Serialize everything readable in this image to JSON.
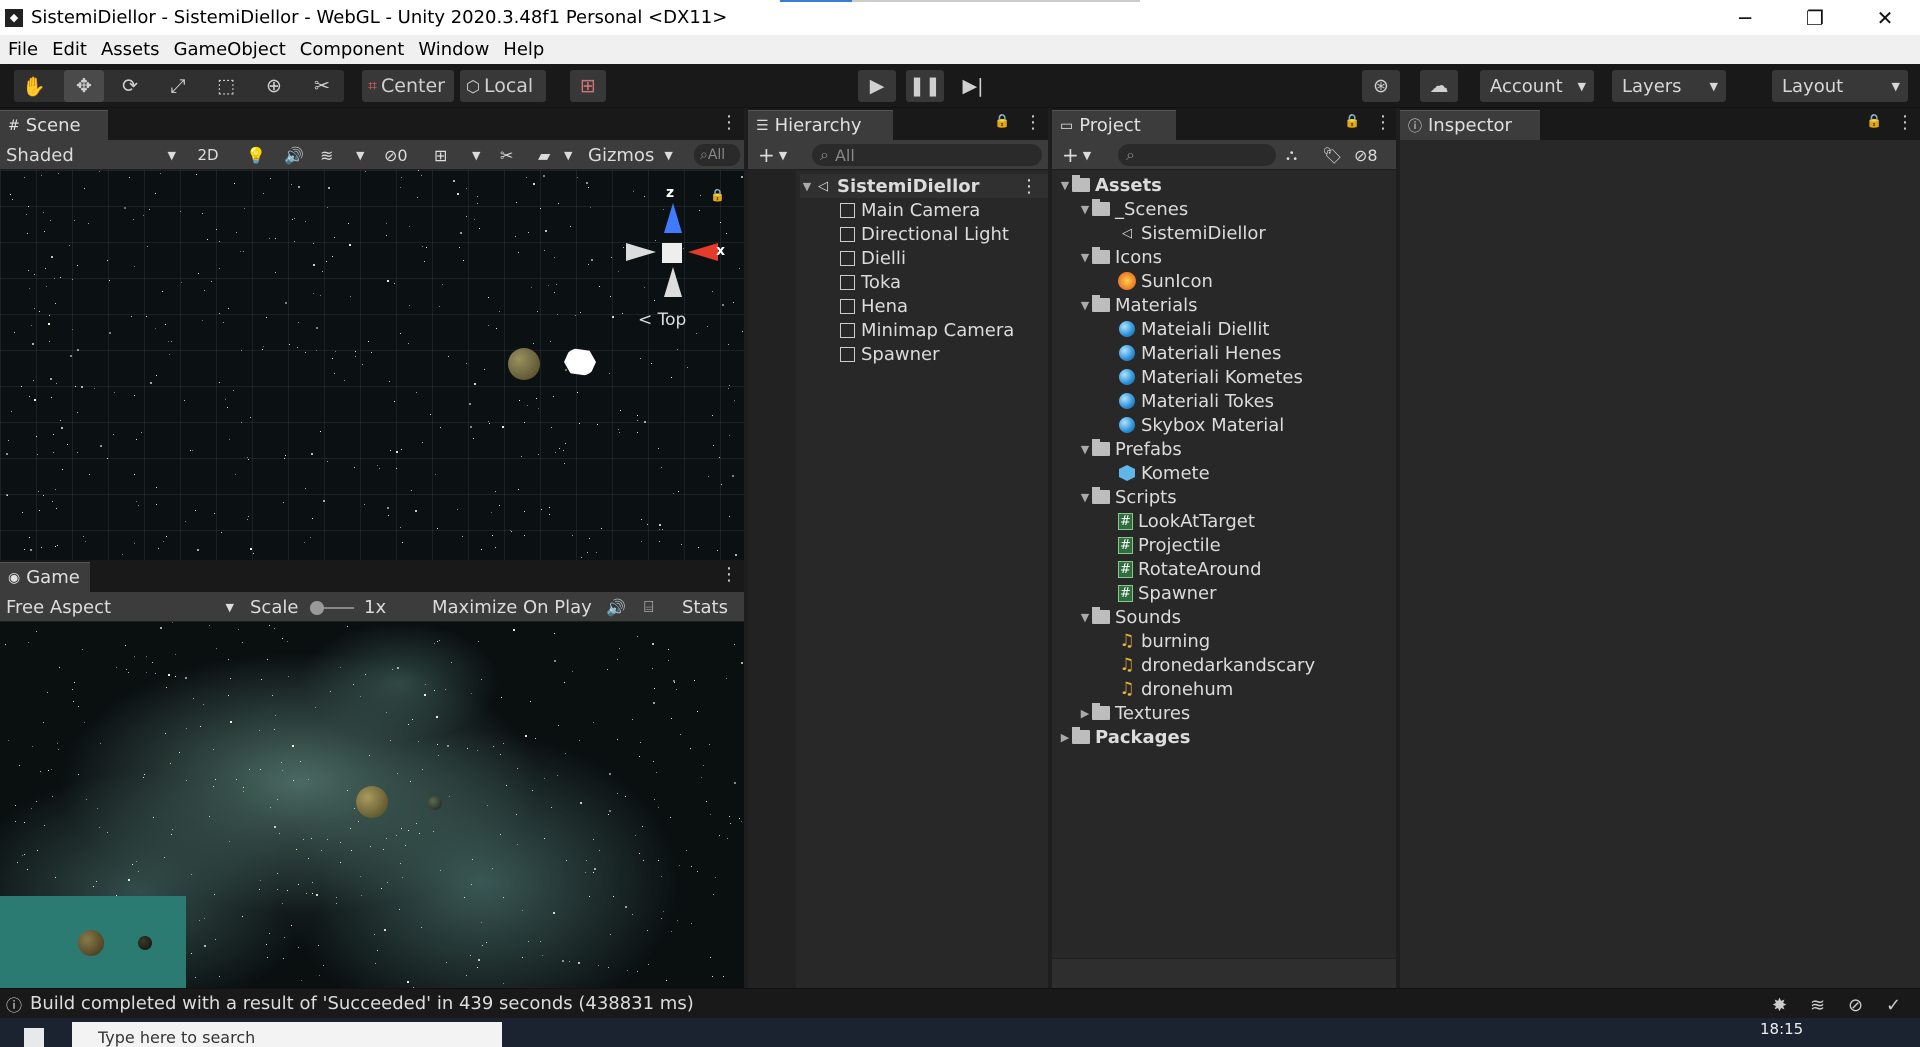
{
  "window": {
    "title": "SistemiDiellor - SistemiDiellor - WebGL - Unity 2020.3.48f1 Personal <DX11>",
    "minimize": "─",
    "restore": "❐",
    "close": "✕"
  },
  "menu": [
    "File",
    "Edit",
    "Assets",
    "GameObject",
    "Component",
    "Window",
    "Help"
  ],
  "toolbar": {
    "pivot_center": "Center",
    "pivot_local": "Local",
    "account": "Account",
    "layers": "Layers",
    "layout": "Layout"
  },
  "scene": {
    "tab": "Scene",
    "shading": "Shaded",
    "mode_2d": "2D",
    "hidden_count": "0",
    "gizmos": "Gizmos",
    "search_placeholder": "All",
    "view_label": "< Top",
    "axis_z": "z",
    "axis_x": "x"
  },
  "game": {
    "tab": "Game",
    "aspect": "Free Aspect",
    "scale_label": "Scale",
    "scale_value": "1x",
    "maximize": "Maximize On Play",
    "stats": "Stats"
  },
  "hierarchy": {
    "tab": "Hierarchy",
    "search_placeholder": "All",
    "scene_name": "SistemiDiellor",
    "items": [
      "Main Camera",
      "Directional Light",
      "Dielli",
      "Toka",
      "Hena",
      "Minimap Camera",
      "Spawner"
    ]
  },
  "project": {
    "tab": "Project",
    "hidden_count": "8",
    "assets_label": "Assets",
    "packages_label": "Packages",
    "folders": [
      {
        "name": "_Scenes",
        "items": [
          {
            "name": "SistemiDiellor",
            "icon": "unity-scene-icon"
          }
        ]
      },
      {
        "name": "Icons",
        "items": [
          {
            "name": "SunIcon",
            "icon": "sun-texture-icon"
          }
        ]
      },
      {
        "name": "Materials",
        "items": [
          {
            "name": "Mateiali Diellit",
            "icon": "material-icon"
          },
          {
            "name": "Materiali Henes",
            "icon": "material-icon"
          },
          {
            "name": "Materiali Kometes",
            "icon": "material-icon"
          },
          {
            "name": "Materiali Tokes",
            "icon": "material-icon"
          },
          {
            "name": "Skybox Material",
            "icon": "material-icon"
          }
        ]
      },
      {
        "name": "Prefabs",
        "items": [
          {
            "name": "Komete",
            "icon": "prefab-icon"
          }
        ]
      },
      {
        "name": "Scripts",
        "items": [
          {
            "name": "LookAtTarget",
            "icon": "script-icon"
          },
          {
            "name": "Projectile",
            "icon": "script-icon"
          },
          {
            "name": "RotateAround",
            "icon": "script-icon"
          },
          {
            "name": "Spawner",
            "icon": "script-icon"
          }
        ]
      },
      {
        "name": "Sounds",
        "items": [
          {
            "name": "burning",
            "icon": "audio-icon"
          },
          {
            "name": "dronedarkandscary",
            "icon": "audio-icon"
          },
          {
            "name": "dronehum",
            "icon": "audio-icon"
          }
        ]
      },
      {
        "name": "Textures",
        "items": []
      }
    ]
  },
  "inspector": {
    "tab": "Inspector"
  },
  "status": {
    "message": "Build completed with a result of 'Succeeded' in 439 seconds (438831 ms)"
  },
  "taskbar": {
    "time": "18:15",
    "search_placeholder": "Type here to search"
  },
  "colors": {
    "panel": "#282828",
    "toolbar": "#191919",
    "tab_active": "#3c3c3c",
    "material_blue": "#2b8fd6",
    "script_green": "#2f6d3a",
    "audio_orange": "#e9b43a"
  }
}
